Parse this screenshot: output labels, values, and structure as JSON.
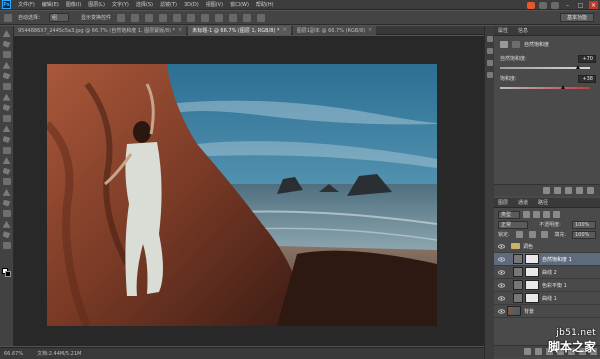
{
  "app": {
    "logo": "Ps"
  },
  "menu": [
    "文件(F)",
    "编辑(E)",
    "图像(I)",
    "图层(L)",
    "文字(Y)",
    "选择(S)",
    "滤镜(T)",
    "3D(D)",
    "视图(V)",
    "窗口(W)",
    "帮助(H)"
  ],
  "options": {
    "auto_select_label": "自动选择：",
    "auto_select_value": "组",
    "transform_label": "显示变换控件",
    "workspace": "基本功能"
  },
  "tabs": [
    {
      "label": "9544886X7_2445c5a3.jpg @ 66.7% (自然饱和度 1, 图层蒙版/8) *",
      "active": false
    },
    {
      "label": "未标题-1 @ 66.7% (图层 1, RGB/8) *",
      "active": true
    },
    {
      "label": "图层1副本 @ 66.7% (RGB/8)",
      "active": false
    }
  ],
  "status": {
    "zoom": "66.67%",
    "doc": "文档:2.44M/5.21M"
  },
  "properties": {
    "tab_props": "属性",
    "tab_info": "信息",
    "title": "自然饱和度",
    "vibrance_label": "自然饱和度:",
    "vibrance_value": "+70",
    "saturation_label": "饱和度:",
    "saturation_value": "+38"
  },
  "layers": {
    "tab_layers": "图层",
    "tab_channels": "通道",
    "tab_paths": "路径",
    "kind": "类型",
    "blend_mode": "正常",
    "opacity_label": "不透明度:",
    "opacity_value": "100%",
    "lock_label": "锁定:",
    "fill_label": "填充:",
    "fill_value": "100%",
    "items": [
      {
        "name": "调色",
        "type": "group",
        "selected": false
      },
      {
        "name": "自然饱和度 1",
        "type": "adjustment",
        "selected": true
      },
      {
        "name": "曲线 2",
        "type": "adjustment",
        "selected": false
      },
      {
        "name": "色彩平衡 1",
        "type": "adjustment",
        "selected": false
      },
      {
        "name": "曲线 1",
        "type": "adjustment",
        "selected": false
      },
      {
        "name": "背景",
        "type": "image",
        "selected": false
      }
    ]
  },
  "watermark": {
    "site": "jb51.net",
    "name": "脚本之家"
  }
}
